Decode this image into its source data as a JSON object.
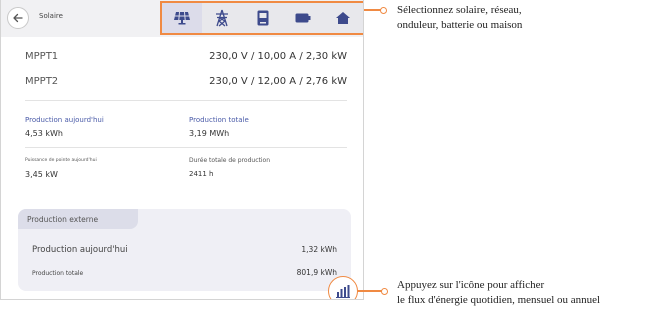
{
  "header": {
    "back_icon": "arrow-left-icon",
    "title": "Solaire",
    "tabs": [
      {
        "icon": "solar-panel-icon",
        "active": true
      },
      {
        "icon": "power-tower-icon",
        "active": false
      },
      {
        "icon": "inverter-icon",
        "active": false
      },
      {
        "icon": "battery-icon",
        "active": false
      },
      {
        "icon": "home-icon",
        "active": false
      }
    ]
  },
  "mppt": [
    {
      "label": "MPPT1",
      "value": "230,0 V / 10,00 A / 2,30 kW"
    },
    {
      "label": "MPPT2",
      "value": "230,0 V / 12,00 A / 2,76 kW"
    }
  ],
  "stats": {
    "today_title": "Production aujourd'hui",
    "today_value": "4,53 kWh",
    "total_title": "Production totale",
    "total_value": "3,19 MWh",
    "peak_title": "Puissance de pointe aujourd'hui",
    "peak_value": "3,45 kW",
    "duration_title": "Durée totale de production",
    "duration_value": "2411 h"
  },
  "external": {
    "title": "Production externe",
    "today_label": "Production aujourd'hui",
    "today_value": "1,32 kWh",
    "total_label": "Production totale",
    "total_value": "801,9 kWh"
  },
  "stats_button_icon": "bar-chart-icon",
  "annotations": {
    "top_line1": "Sélectionnez solaire, réseau,",
    "top_line2": "onduleur, batterie ou maison",
    "bottom_line1": "Appuyez sur l'icône pour afficher",
    "bottom_line2": "le flux d'énergie quotidien, mensuel ou annuel"
  },
  "colors": {
    "accent": "#f08a43",
    "icon_blue": "#3d4a8c",
    "label_blue": "#4a5ba8"
  }
}
